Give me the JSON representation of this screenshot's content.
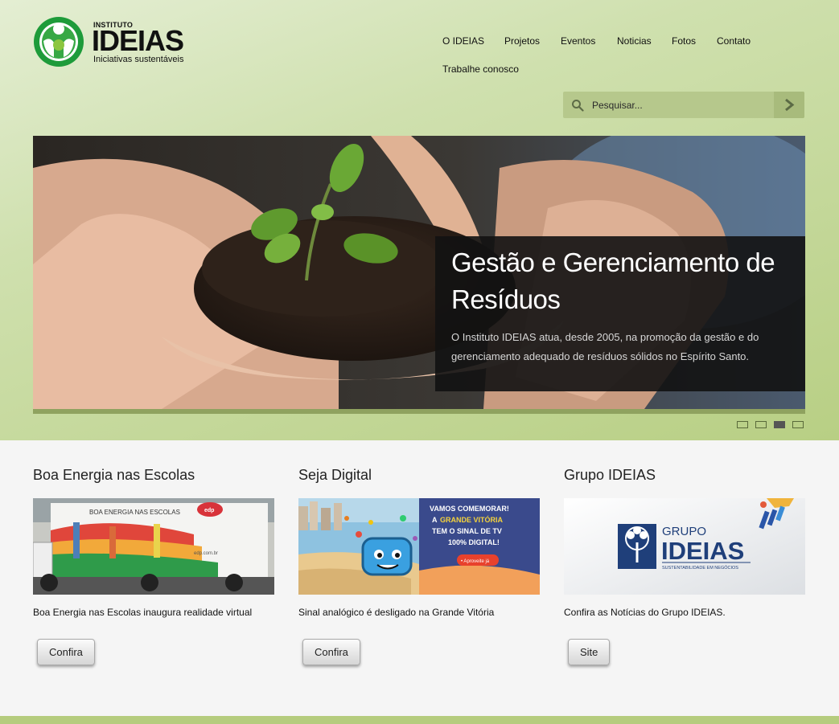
{
  "logo": {
    "small": "INSTITUTO",
    "big": "IDEIAS",
    "tagline": "Iniciativas sustentáveis"
  },
  "nav": {
    "items": [
      "O IDEIAS",
      "Projetos",
      "Eventos",
      "Noticias",
      "Fotos",
      "Contato",
      "Trabalhe conosco"
    ]
  },
  "search": {
    "placeholder": "Pesquisar..."
  },
  "slide": {
    "title": "Gestão e Gerenciamento de Resíduos",
    "text": "O Instituto IDEIAS atua, desde 2005, na promoção da gestão e do gerenciamento adequado de resíduos sólidos no Espírito Santo."
  },
  "slider": {
    "slide_count": 4,
    "active_index": 2
  },
  "columns": [
    {
      "title": "Boa Energia nas Escolas",
      "desc": "Boa Energia nas Escolas inaugura realidade virtual",
      "button": "Confira",
      "image_texts": {
        "banner": "BOA ENERGIA NAS ESCOLAS",
        "brand": "edp",
        "site": "edp.com.br"
      }
    },
    {
      "title": "Seja Digital",
      "desc": "Sinal analógico é desligado na Grande Vitória",
      "button": "Confira",
      "image_texts": {
        "line1": "VAMOS COMEMORAR!",
        "line2a": "A",
        "line2b": "GRANDE VITÓRIA",
        "line3": "TEM O SINAL DE TV",
        "line4": "100% DIGITAL!",
        "cta": "• Aproveite já"
      }
    },
    {
      "title": "Grupo IDEIAS",
      "desc": "Confira as Notícias do Grupo IDEIAS.",
      "button": "Site",
      "image_texts": {
        "small": "GRUPO",
        "big": "IDEIAS",
        "tag": "SUSTENTABILIDADE EM NEGÓCIOS"
      }
    }
  ],
  "colors": {
    "header_green": "#c3d79a",
    "strip_green": "#8fa25f",
    "caption_bg": "#121212"
  }
}
